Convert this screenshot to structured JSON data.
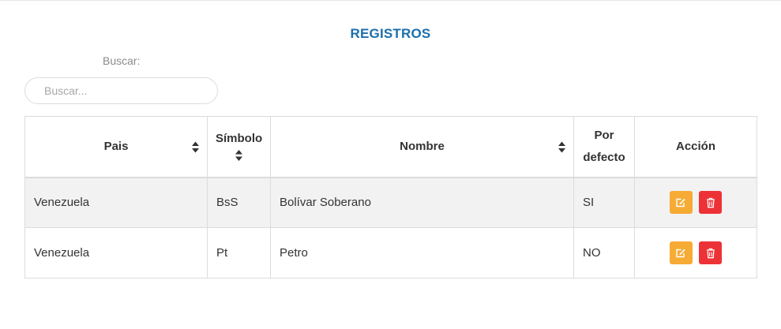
{
  "title": "REGISTROS",
  "search": {
    "label": "Buscar:",
    "placeholder": "Buscar...",
    "value": ""
  },
  "table": {
    "headers": {
      "pais": "Pais",
      "simbolo": "Símbolo",
      "nombre": "Nombre",
      "por_defecto_line1": "Por",
      "por_defecto_line2": "defecto",
      "accion": "Acción"
    },
    "rows": [
      {
        "pais": "Venezuela",
        "simbolo": "BsS",
        "nombre": "Bolívar Soberano",
        "por_defecto": "SI"
      },
      {
        "pais": "Venezuela",
        "simbolo": "Pt",
        "nombre": "Petro",
        "por_defecto": "NO"
      }
    ]
  },
  "colors": {
    "title": "#1a6fad",
    "edit_button": "#f6ab34",
    "delete_button": "#ed3237"
  },
  "icons": {
    "edit": "edit-icon",
    "delete": "trash-icon",
    "sort": "sort-icon"
  }
}
